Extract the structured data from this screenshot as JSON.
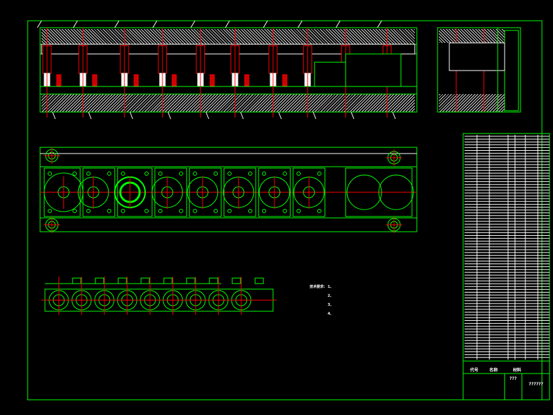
{
  "colors": {
    "background": "#000000",
    "outline": "#00ff00",
    "centerline": "#ff0000",
    "hatch": "#d8d8d8",
    "text": "#ffffff"
  },
  "notes": {
    "heading": "技术要求:",
    "items": [
      "1、",
      "2、",
      "3、",
      "4、"
    ]
  },
  "title_block": {
    "headers": [
      "代号",
      "名称",
      "材料"
    ],
    "title": "???",
    "drawing_no": "??????"
  },
  "stations": 9
}
